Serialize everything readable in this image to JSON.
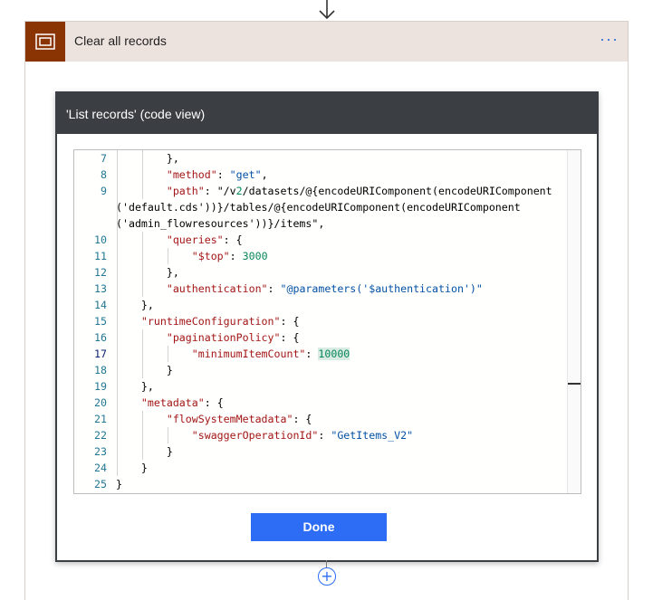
{
  "scope": {
    "title": "Clear all records",
    "more_label": "···",
    "icon": "scope-icon",
    "header_color": "#ede3de",
    "icon_color": "#8a3404"
  },
  "dialog": {
    "title": "'List records' (code view)",
    "done_label": "Done",
    "accent": "#2d6cf5"
  },
  "editor": {
    "active_line": "17",
    "lines": [
      {
        "n": "7",
        "t": "        },"
      },
      {
        "n": "8",
        "t": "        \"method\": \"get\","
      },
      {
        "n": "9",
        "t": "        \"path\": \"/v2/datasets/@{encodeURIComponent(encodeURIComponent"
      },
      {
        "n": "",
        "t": "('default.cds'))}/tables/@{encodeURIComponent(encodeURIComponent"
      },
      {
        "n": "",
        "t": "('admin_flowresources'))}/items\","
      },
      {
        "n": "10",
        "t": "        \"queries\": {"
      },
      {
        "n": "11",
        "t": "            \"$top\": 3000"
      },
      {
        "n": "12",
        "t": "        },"
      },
      {
        "n": "13",
        "t": "        \"authentication\": \"@parameters('$authentication')\""
      },
      {
        "n": "14",
        "t": "    },"
      },
      {
        "n": "15",
        "t": "    \"runtimeConfiguration\": {"
      },
      {
        "n": "16",
        "t": "        \"paginationPolicy\": {"
      },
      {
        "n": "17",
        "t": "            \"minimumItemCount\": 10000"
      },
      {
        "n": "18",
        "t": "        }"
      },
      {
        "n": "19",
        "t": "    },"
      },
      {
        "n": "20",
        "t": "    \"metadata\": {"
      },
      {
        "n": "21",
        "t": "        \"flowSystemMetadata\": {"
      },
      {
        "n": "22",
        "t": "            \"swaggerOperationId\": \"GetItems_V2\""
      },
      {
        "n": "23",
        "t": "        }"
      },
      {
        "n": "24",
        "t": "    }"
      },
      {
        "n": "25",
        "t": "}"
      }
    ]
  },
  "add_step_label": "+"
}
